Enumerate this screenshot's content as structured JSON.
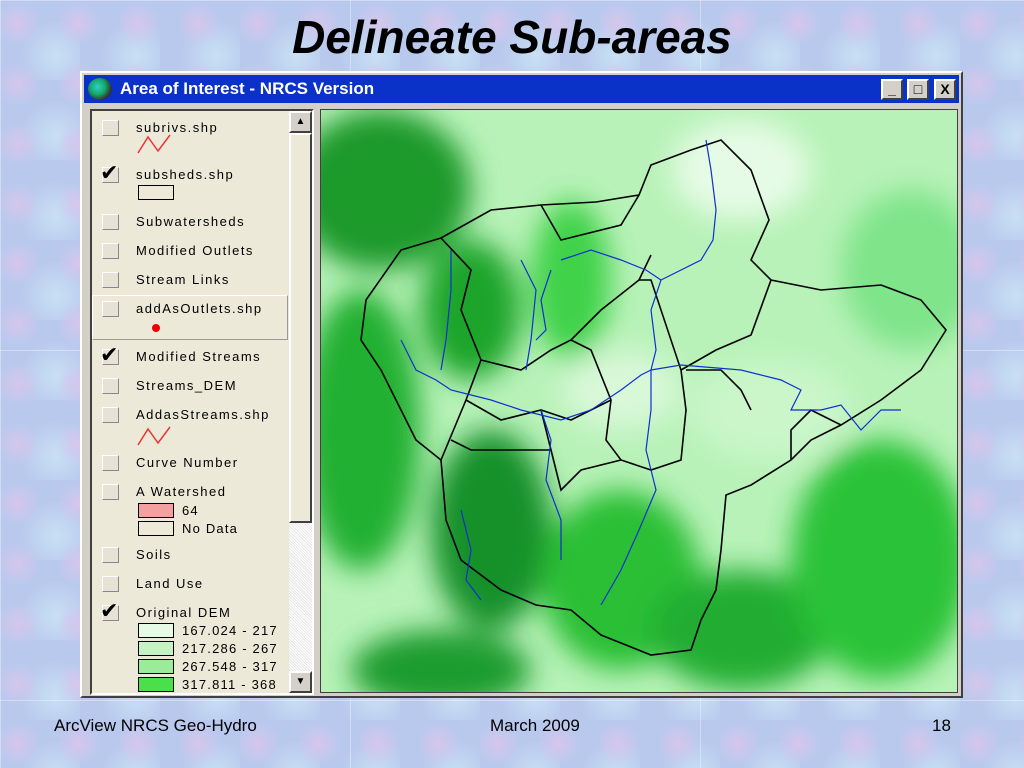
{
  "slide": {
    "title": "Delineate Sub-areas",
    "footer_left": "ArcView NRCS Geo-Hydro",
    "footer_center": "March 2009",
    "page_number": "18"
  },
  "window": {
    "title": "Area of Interest - NRCS Version",
    "minimize": "_",
    "maximize": "□",
    "close": "X"
  },
  "legend": {
    "layers": [
      {
        "label": "subrivs.shp",
        "checked": false
      },
      {
        "label": "subsheds.shp",
        "checked": true
      },
      {
        "label": "Subwatersheds",
        "checked": false
      },
      {
        "label": "Modified Outlets",
        "checked": false
      },
      {
        "label": "Stream Links",
        "checked": false
      },
      {
        "label": "addAsOutlets.shp",
        "checked": false
      },
      {
        "label": "Modified Streams",
        "checked": true
      },
      {
        "label": "Streams_DEM",
        "checked": false
      },
      {
        "label": "AddasStreams.shp",
        "checked": false
      },
      {
        "label": "Curve Number",
        "checked": false
      },
      {
        "label": "A Watershed",
        "checked": false
      },
      {
        "label": "Soils",
        "checked": false
      },
      {
        "label": "Land Use",
        "checked": false
      },
      {
        "label": "Original DEM",
        "checked": true
      }
    ],
    "awatershed_classes": [
      {
        "label": "64",
        "color": "#f4a0a0"
      },
      {
        "label": "No Data",
        "color": "#ece9d8"
      }
    ],
    "dem_classes": [
      {
        "label": "167.024 - 217",
        "color": "#e6fbe6"
      },
      {
        "label": "217.286 - 267",
        "color": "#c4f4c4"
      },
      {
        "label": "267.548 - 317",
        "color": "#9aeb9a"
      },
      {
        "label": "317.811 - 368",
        "color": "#4be04b"
      }
    ],
    "check_mark": "✔"
  },
  "colors": {
    "titlebar": "#0a32c8",
    "stream": "#1030d0",
    "boundary": "#000000"
  }
}
